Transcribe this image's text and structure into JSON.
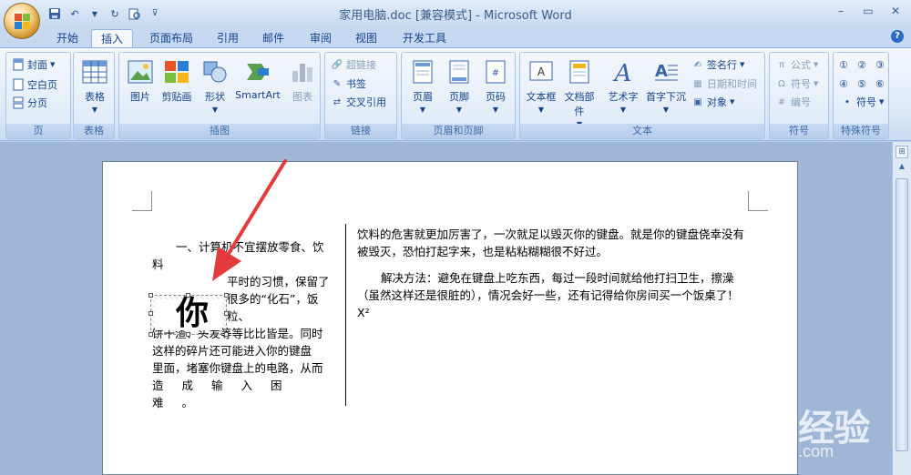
{
  "window": {
    "title": "家用电脑.doc [兼容模式] - Microsoft Word"
  },
  "tabs": [
    {
      "label": "开始"
    },
    {
      "label": "插入"
    },
    {
      "label": "页面布局"
    },
    {
      "label": "引用"
    },
    {
      "label": "邮件"
    },
    {
      "label": "审阅"
    },
    {
      "label": "视图"
    },
    {
      "label": "开发工具"
    }
  ],
  "ribbon": {
    "pages": {
      "label": "页",
      "cover": "封面",
      "blank": "空白页",
      "break": "分页"
    },
    "tables": {
      "label": "表格",
      "table": "表格"
    },
    "illustrations": {
      "label": "插图",
      "picture": "图片",
      "clipart": "剪贴画",
      "shapes": "形状",
      "smartart": "SmartArt",
      "chart": "图表"
    },
    "links": {
      "label": "链接",
      "hyperlink": "超链接",
      "bookmark": "书签",
      "crossref": "交叉引用"
    },
    "headerfooter": {
      "label": "页眉和页脚",
      "header": "页眉",
      "footer": "页脚",
      "pagenum": "页码"
    },
    "text": {
      "label": "文本",
      "textbox": "文本框",
      "quickparts": "文档部件",
      "wordart": "艺术字",
      "dropcap": "首字下沉",
      "signature": "签名行",
      "datetime": "日期和时间",
      "object": "对象"
    },
    "symbols": {
      "label": "符号",
      "equation": "公式",
      "symbol": "符号",
      "number": "编号"
    },
    "special": {
      "label": "特殊符号",
      "c1": "①",
      "c2": "②",
      "c3": "③",
      "c4": "④",
      "c5": "⑤",
      "c6": "⑥",
      "symbol": "符号"
    }
  },
  "document": {
    "left_heading_1": "一、计算机不宜摆放零食、饮",
    "left_heading_2": "料",
    "left_lines": [
      "平时的习惯，保留了",
      "很多的“化石”，饭粒、",
      "饼干渣、头发等等比比皆是。同时",
      "这样的碎片还可能进入你的键盘",
      "里面，堵塞你键盘上的电路，从而",
      "造成输入困难。"
    ],
    "dropcap": "你",
    "right_p1": "饮料的危害就更加厉害了，一次就足以毁灭你的键盘。就是你的键盘侥幸没有被毁灭，恐怕打起字来，也是粘粘糊糊很不好过。",
    "right_p2": "解决方法：避免在键盘上吃东西，每过一段时间就给他打扫卫生，擦澡（虽然这样还是很脏的），情况会好一些，还有记得给你房间买一个饭桌了！X²"
  },
  "watermark": {
    "brand": "Baidu经验",
    "url": "jingyan.baidu.com"
  }
}
